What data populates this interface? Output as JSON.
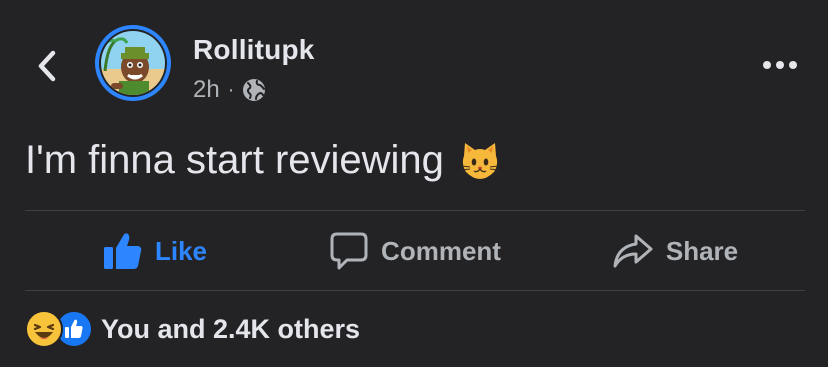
{
  "header": {
    "author_name": "Rollitupk",
    "timestamp": "2h",
    "separator": "·",
    "privacy_icon": "globe-icon"
  },
  "post": {
    "text": "I'm finna start reviewing",
    "emoji_icon": "cat-face-emoji"
  },
  "actions": {
    "like_label": "Like",
    "comment_label": "Comment",
    "share_label": "Share"
  },
  "reactions": {
    "summary": "You and 2.4K others",
    "icons": [
      "laugh-reaction-icon",
      "like-reaction-icon"
    ]
  },
  "colors": {
    "background": "#232325",
    "accent_blue": "#2d86ff",
    "text_primary": "#e4e6eb",
    "text_secondary": "#b0b3b8",
    "divider": "#3e4042"
  }
}
